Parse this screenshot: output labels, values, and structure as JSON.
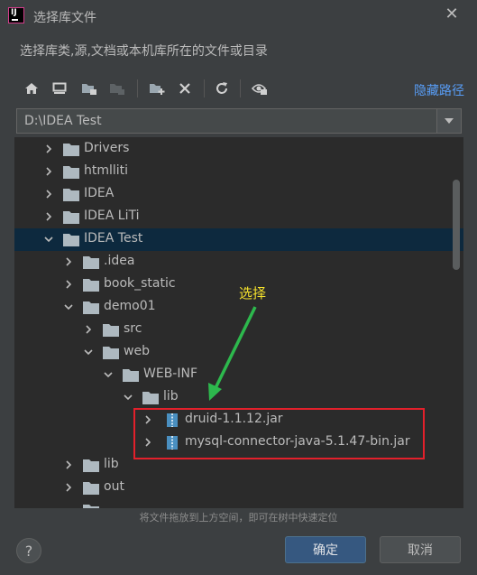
{
  "window": {
    "title": "选择库文件"
  },
  "description": "选择库类,源,文档或本机库所在的文件或目录",
  "toolbar": {
    "hide_path": "隐藏路径"
  },
  "path_field": {
    "value": "D:\\IDEA Test"
  },
  "tree": {
    "rows": [
      {
        "label": "Drivers",
        "expanded": false,
        "type": "folder",
        "selected": false
      },
      {
        "label": "htmlliti",
        "expanded": false,
        "type": "folder",
        "selected": false
      },
      {
        "label": "IDEA",
        "expanded": false,
        "type": "folder",
        "selected": false
      },
      {
        "label": "IDEA LiTi",
        "expanded": false,
        "type": "folder",
        "selected": false
      },
      {
        "label": "IDEA Test",
        "expanded": true,
        "type": "folder",
        "selected": true
      },
      {
        "label": ".idea",
        "expanded": false,
        "type": "folder",
        "selected": false
      },
      {
        "label": "book_static",
        "expanded": false,
        "type": "folder",
        "selected": false
      },
      {
        "label": "demo01",
        "expanded": true,
        "type": "folder",
        "selected": false
      },
      {
        "label": "src",
        "expanded": false,
        "type": "folder",
        "selected": false
      },
      {
        "label": "web",
        "expanded": true,
        "type": "folder",
        "selected": false
      },
      {
        "label": "WEB-INF",
        "expanded": true,
        "type": "folder",
        "selected": false
      },
      {
        "label": "lib",
        "expanded": true,
        "type": "folder",
        "selected": false
      },
      {
        "label": "druid-1.1.12.jar",
        "expanded": false,
        "type": "jar",
        "selected": false
      },
      {
        "label": "mysql-connector-java-5.1.47-bin.jar",
        "expanded": false,
        "type": "jar",
        "selected": false
      },
      {
        "label": "lib",
        "expanded": false,
        "type": "folder",
        "selected": false
      },
      {
        "label": "out",
        "expanded": false,
        "type": "folder",
        "selected": false
      }
    ]
  },
  "annotation": {
    "text": "选择",
    "color": "#f3e02c",
    "arrow_color": "#2db84d",
    "box_color": "#e3202b"
  },
  "drop_hint": "将文件拖放到上方空间，即可在树中快速定位",
  "buttons": {
    "help": "?",
    "ok": "确定",
    "cancel": "取消"
  },
  "colors": {
    "accent": "#589df6",
    "selection": "#0d293e",
    "primary_button": "#365880"
  }
}
